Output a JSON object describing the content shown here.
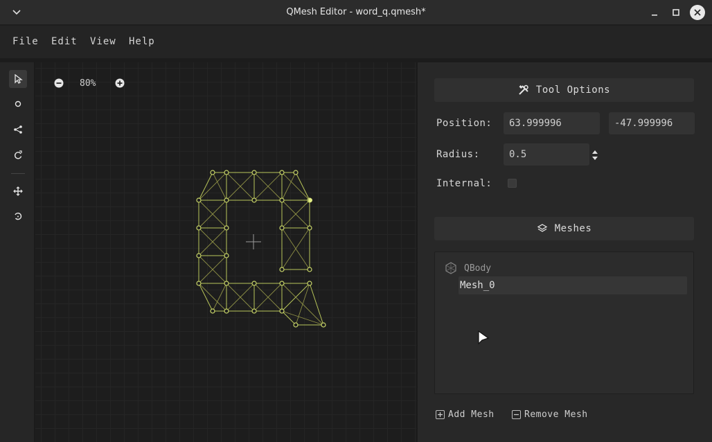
{
  "window": {
    "title": "QMesh Editor - word_q.qmesh*"
  },
  "icons": {
    "menu": "chevron-down-icon",
    "minimize": "minimize-icon",
    "maximize": "maximize-icon",
    "close": "close-icon"
  },
  "menubar": {
    "items": [
      "File",
      "Edit",
      "View",
      "Help"
    ]
  },
  "toolbar": {
    "tools": [
      "select-tool",
      "add-node-tool",
      "connect-tool",
      "rotate-add-tool",
      "move-tool",
      "rotate-tool"
    ],
    "active": "select-tool"
  },
  "canvas": {
    "zoom": "80%"
  },
  "tool_options": {
    "title": "Tool Options",
    "position_label": "Position:",
    "position_x": "63.999996",
    "position_y": "-47.999996",
    "radius_label": "Radius:",
    "radius_value": "0.5",
    "internal_label": "Internal:",
    "internal_checked": false
  },
  "meshes": {
    "title": "Meshes",
    "body_name": "QBody",
    "items": [
      "Mesh_0"
    ]
  },
  "actions": {
    "add_mesh": "Add Mesh",
    "remove_mesh": "Remove Mesh"
  },
  "colors": {
    "mesh_line": "#b9c75a",
    "accent_close": "#e8e8e8"
  }
}
